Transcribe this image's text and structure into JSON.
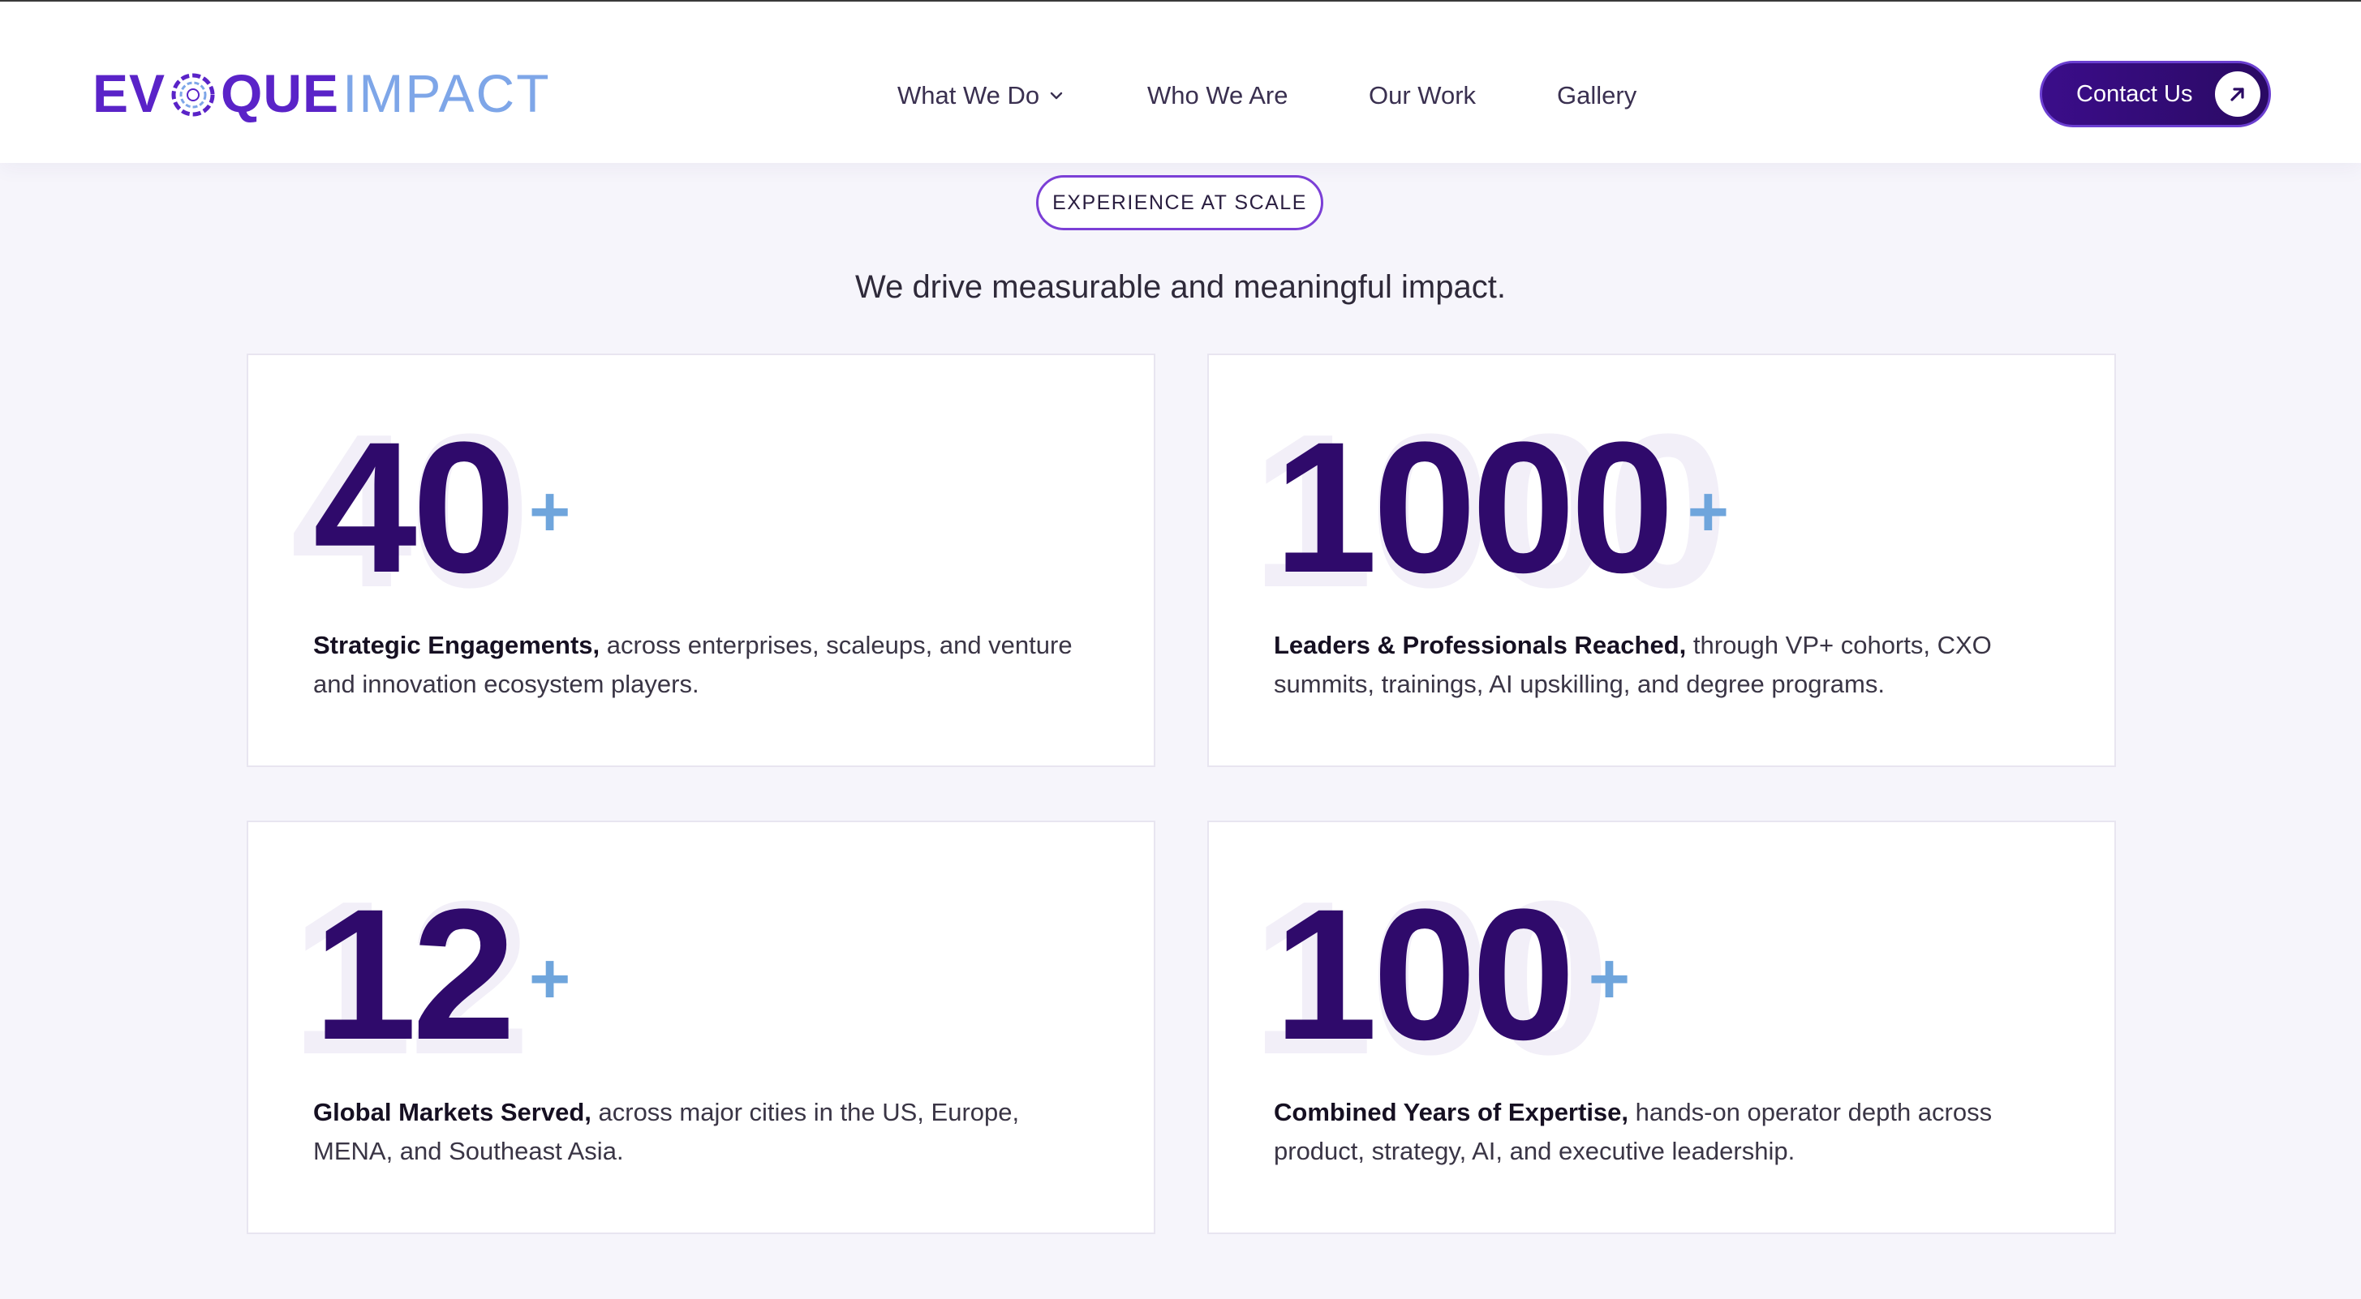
{
  "brand": {
    "name_part1": "EV",
    "name_part2": "QUE",
    "name_part3": "IMPACT",
    "primary_color": "#5a23c8",
    "secondary_color": "#7ea6e8"
  },
  "nav": {
    "items": [
      {
        "label": "What We Do",
        "has_dropdown": true
      },
      {
        "label": "Who We Are"
      },
      {
        "label": "Our Work"
      },
      {
        "label": "Gallery"
      }
    ],
    "contact_label": "Contact Us"
  },
  "section": {
    "badge": "EXPERIENCE AT SCALE",
    "subtitle": "We drive measurable and meaningful impact."
  },
  "stats": [
    {
      "number": "40",
      "suffix": "+",
      "title": "Strategic Engagements,",
      "text": "across enterprises, scaleups, and venture and innovation ecosystem players."
    },
    {
      "number": "1000",
      "suffix": "+",
      "title": "Leaders & Professionals Reached,",
      "text": "through VP+ cohorts, CXO summits, trainings, AI upskilling, and degree programs."
    },
    {
      "number": "12",
      "suffix": "+",
      "title": "Global Markets Served,",
      "text": "across major cities in the US, Europe, MENA, and Southeast Asia."
    },
    {
      "number": "100",
      "suffix": "+",
      "title": "Combined Years of Expertise,",
      "text": "hands-on operator depth across product, strategy, AI, and executive leadership."
    }
  ],
  "colors": {
    "stat_number": "#2f0a6b",
    "stat_plus": "#6fa5dc",
    "page_background": "#f6f5fb"
  }
}
